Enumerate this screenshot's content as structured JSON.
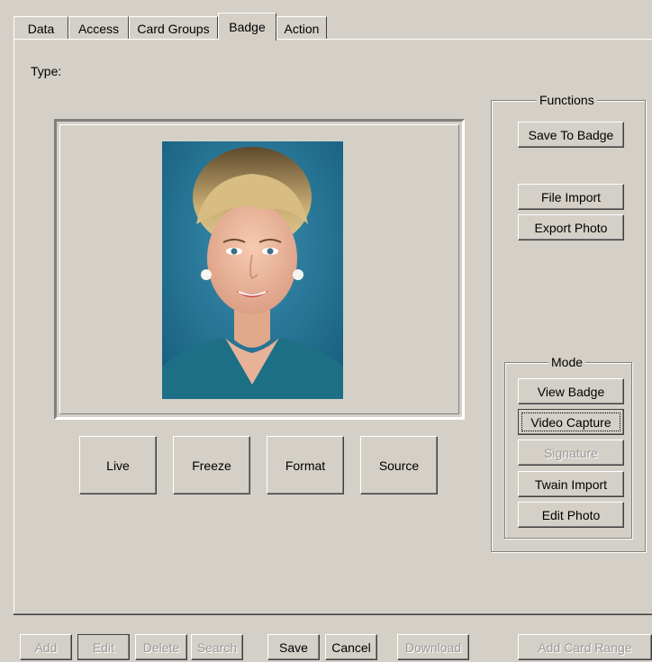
{
  "tabs": [
    "Data",
    "Access",
    "Card Groups",
    "Badge",
    "Action"
  ],
  "active_tab": "Badge",
  "type_label": "Type:",
  "photo_description": "portrait-photo",
  "capture_buttons": [
    "Live",
    "Freeze",
    "Format",
    "Source"
  ],
  "functions": {
    "title": "Functions",
    "save_to_badge": "Save To Badge",
    "file_import": "File Import",
    "export_photo": "Export Photo"
  },
  "mode": {
    "title": "Mode",
    "view_badge": "View Badge",
    "video_capture": "Video Capture",
    "signature": "Signature",
    "twain_import": "Twain Import",
    "edit_photo": "Edit Photo"
  },
  "bottom_bar": {
    "add": "Add",
    "edit": "Edit",
    "delete": "Delete",
    "search": "Search",
    "save": "Save",
    "cancel": "Cancel",
    "download": "Download",
    "add_card_range": "Add Card Range"
  },
  "colors": {
    "face": "#d4d0c8",
    "photo_background": "#1f6f8f"
  }
}
